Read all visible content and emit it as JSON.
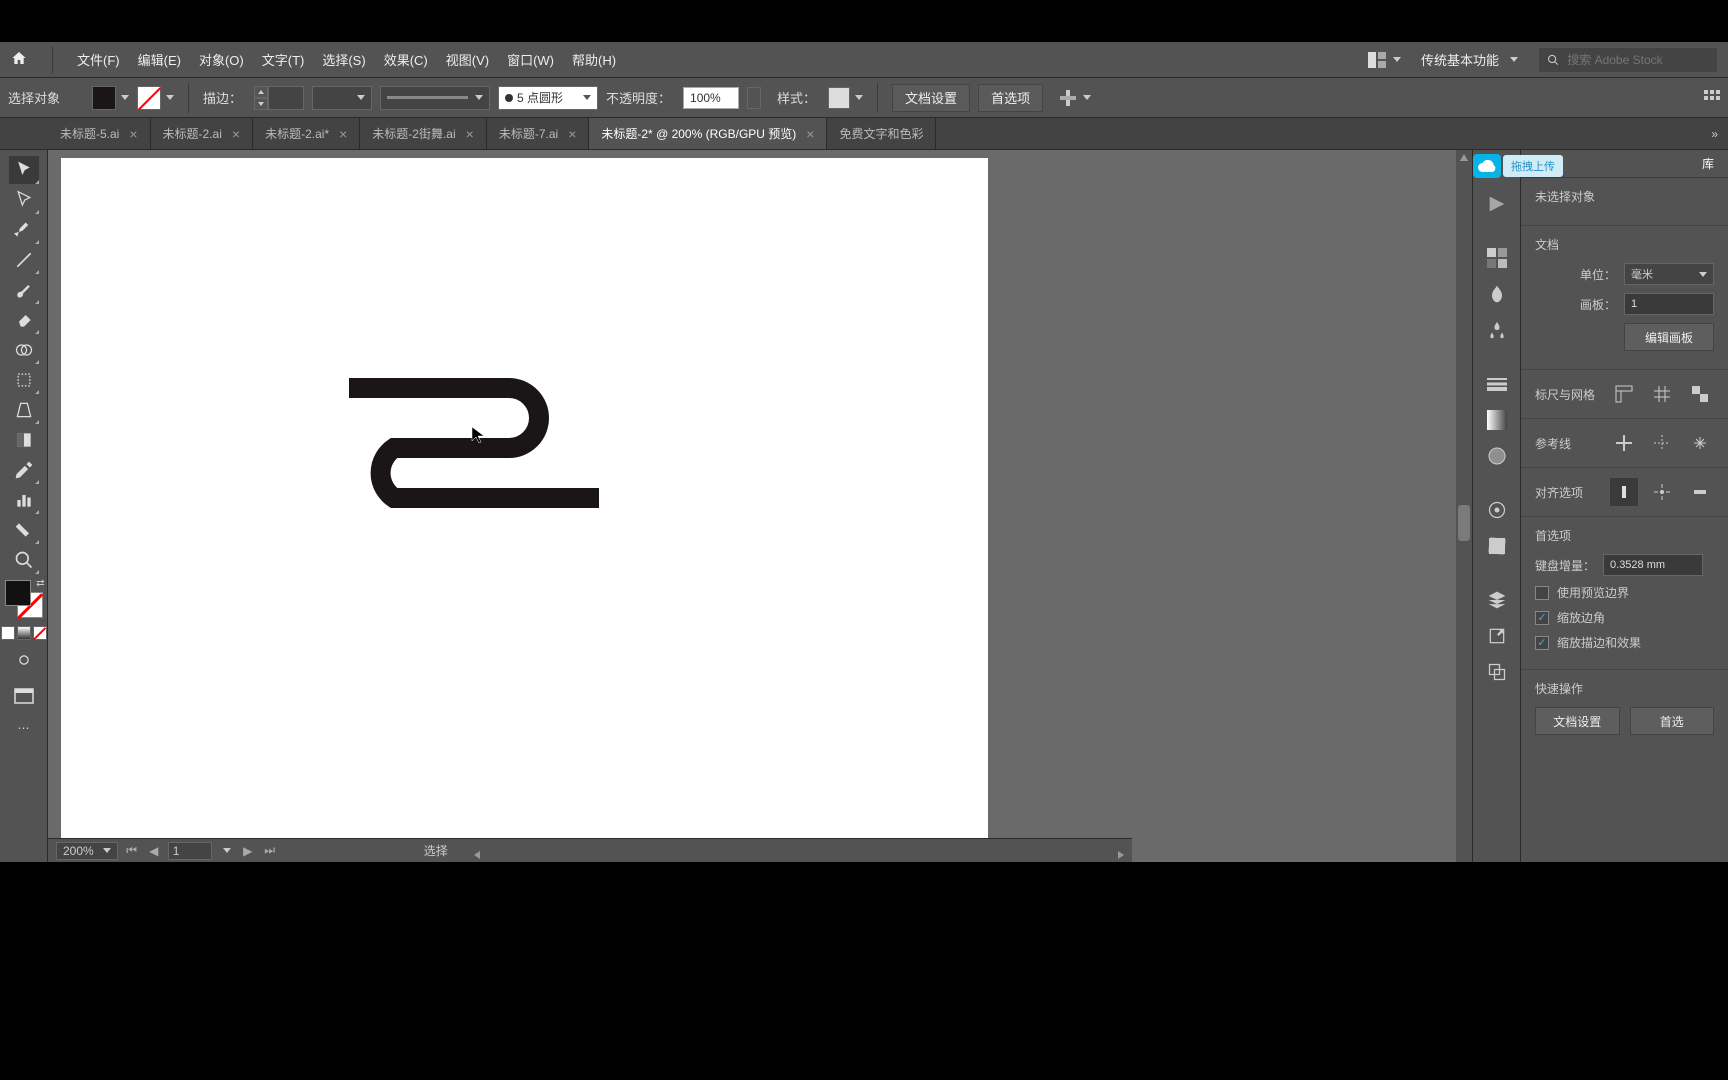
{
  "window": {
    "title_bar_color": "#000"
  },
  "menu": {
    "items": [
      "文件(F)",
      "编辑(E)",
      "对象(O)",
      "文字(T)",
      "选择(S)",
      "效果(C)",
      "视图(V)",
      "窗口(W)",
      "帮助(H)"
    ],
    "workspace": "传统基本功能",
    "search_placeholder": "搜索 Adobe Stock"
  },
  "control": {
    "context_label": "选择对象",
    "stroke_label": "描边：",
    "stroke_value": "",
    "stroke_profile": "5 点圆形",
    "opacity_label": "不透明度：",
    "opacity_value": "100%",
    "style_label": "样式：",
    "doc_setup": "文档设置",
    "preferences": "首选项"
  },
  "tabs": [
    {
      "label": "未标题-5.ai",
      "active": false
    },
    {
      "label": "未标题-2.ai",
      "active": false
    },
    {
      "label": "未标题-2.ai*",
      "active": false
    },
    {
      "label": "未标题-2街舞.ai",
      "active": false
    },
    {
      "label": "未标题-7.ai",
      "active": false
    },
    {
      "label": "未标题-2* @ 200% (RGB/GPU 预览)",
      "active": true
    },
    {
      "label": "免费文字和色彩",
      "active": false
    }
  ],
  "cloud_tooltip": "拖拽上传",
  "properties": {
    "panel_tabs": [
      "库"
    ],
    "no_selection": "未选择对象",
    "doc_section": "文档",
    "unit_label": "单位：",
    "unit_value": "毫米",
    "artboard_label": "画板：",
    "artboard_value": "1",
    "edit_artboards": "编辑画板",
    "rulers_section": "标尺与网格",
    "guides_section": "参考线",
    "align_section": "对齐选项",
    "prefs_section": "首选项",
    "key_increment_label": "键盘增量：",
    "key_increment_value": "0.3528 mm",
    "use_preview_bounds": "使用预览边界",
    "scale_corners": "缩放边角",
    "scale_strokes": "缩放描边和效果",
    "quick_actions": "快速操作",
    "doc_setup_btn": "文档设置",
    "prefs_btn": "首选"
  },
  "status": {
    "zoom": "200%",
    "artboard": "1",
    "tool": "选择"
  }
}
